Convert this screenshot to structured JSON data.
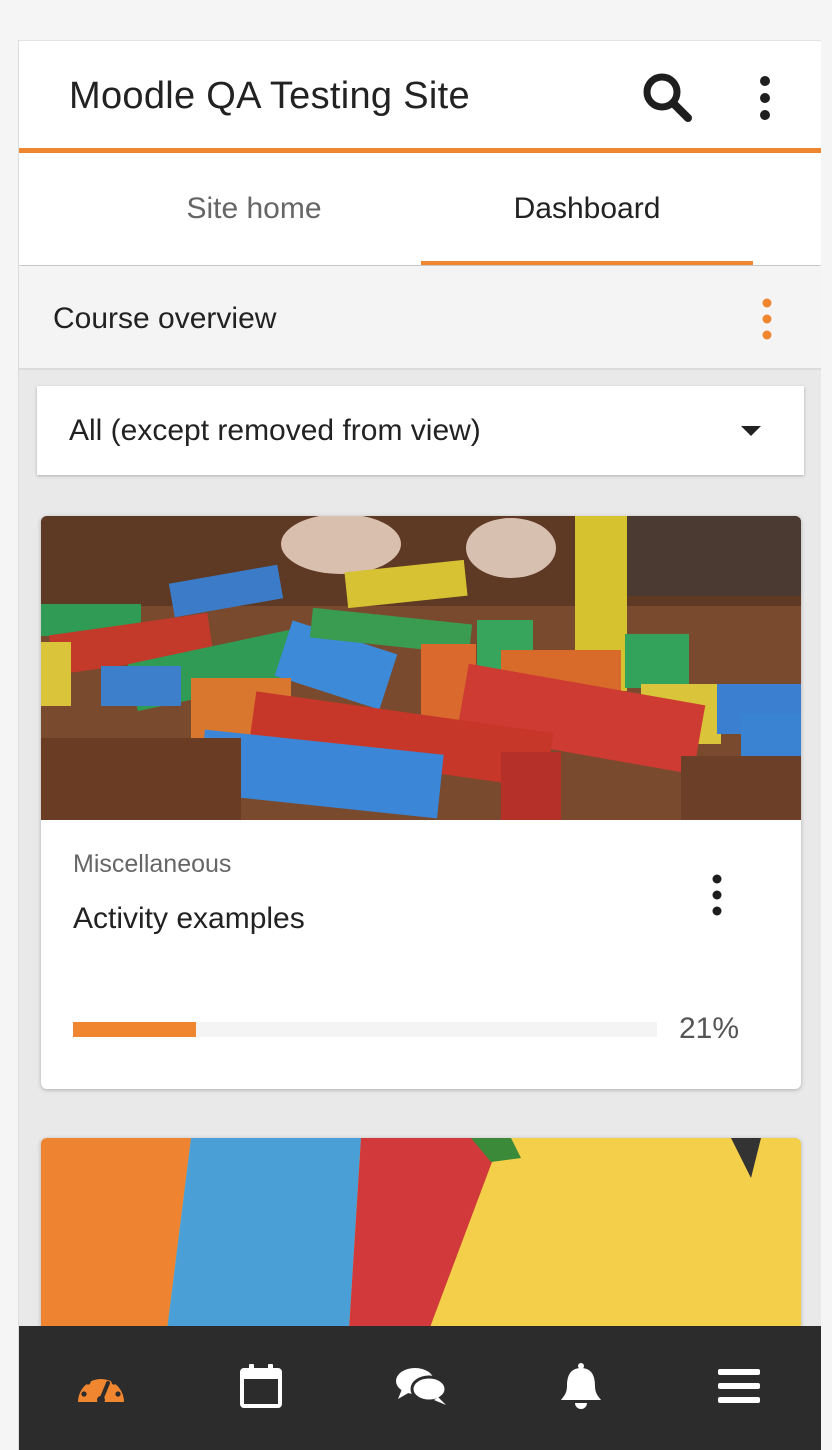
{
  "header": {
    "title": "Moodle QA Testing Site",
    "search_icon": "search-icon",
    "menu_icon": "more-vertical-icon"
  },
  "tabs": [
    {
      "label": "Site home",
      "active": false
    },
    {
      "label": "Dashboard",
      "active": true
    }
  ],
  "block": {
    "title": "Course overview",
    "menu_icon": "more-vertical-icon"
  },
  "filter": {
    "selected": "All (except removed from view)"
  },
  "courses": [
    {
      "category": "Miscellaneous",
      "name": "Activity examples",
      "progress": 21,
      "progress_label": "21%",
      "image": "wooden-blocks-image"
    },
    {
      "category": "",
      "name": "",
      "image": "colored-paper-image"
    }
  ],
  "bottom_nav": [
    {
      "icon": "dashboard-gauge-icon",
      "active": true
    },
    {
      "icon": "calendar-icon",
      "active": false
    },
    {
      "icon": "messages-icon",
      "active": false
    },
    {
      "icon": "notifications-bell-icon",
      "active": false
    },
    {
      "icon": "hamburger-menu-icon",
      "active": false
    }
  ],
  "colors": {
    "accent": "#f0862f",
    "nav_bg": "#2c2c2c",
    "nav_icon": "#ffffff"
  }
}
